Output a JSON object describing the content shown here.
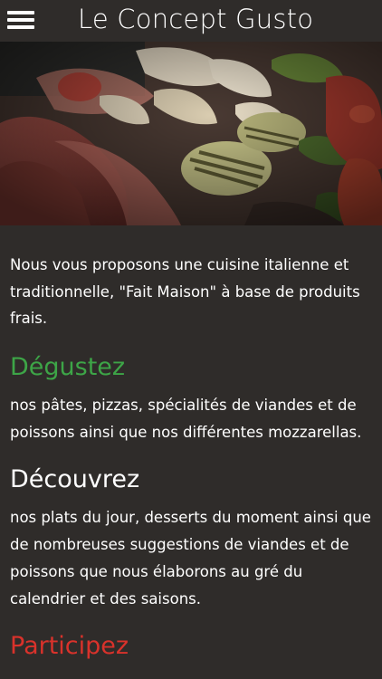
{
  "header": {
    "title": "Le Concept Gusto",
    "menu_icon": "hamburger-menu-icon"
  },
  "hero": {
    "image": "italian-antipasti-plate"
  },
  "intro": {
    "text": "Nous vous proposons une cuisine italienne et traditionnelle, \"Fait Maison\" à base de produits frais."
  },
  "sections": [
    {
      "heading": "Dégustez",
      "color": "#3da547",
      "text": "nos pâtes, pizzas, spécialités de viandes et de poissons ainsi que nos différentes mozzarellas."
    },
    {
      "heading": "Découvrez",
      "color": "#ffffff",
      "text": "nos plats du jour, desserts du moment ainsi que de nombreuses suggestions de viandes et de poissons que nous élaborons au gré du calendrier et des saisons."
    },
    {
      "heading": "Participez",
      "color": "#d9322b",
      "text": ""
    }
  ],
  "colors": {
    "background": "#2f2c2a",
    "text": "#ffffff",
    "green": "#3da547",
    "red": "#d9322b"
  }
}
